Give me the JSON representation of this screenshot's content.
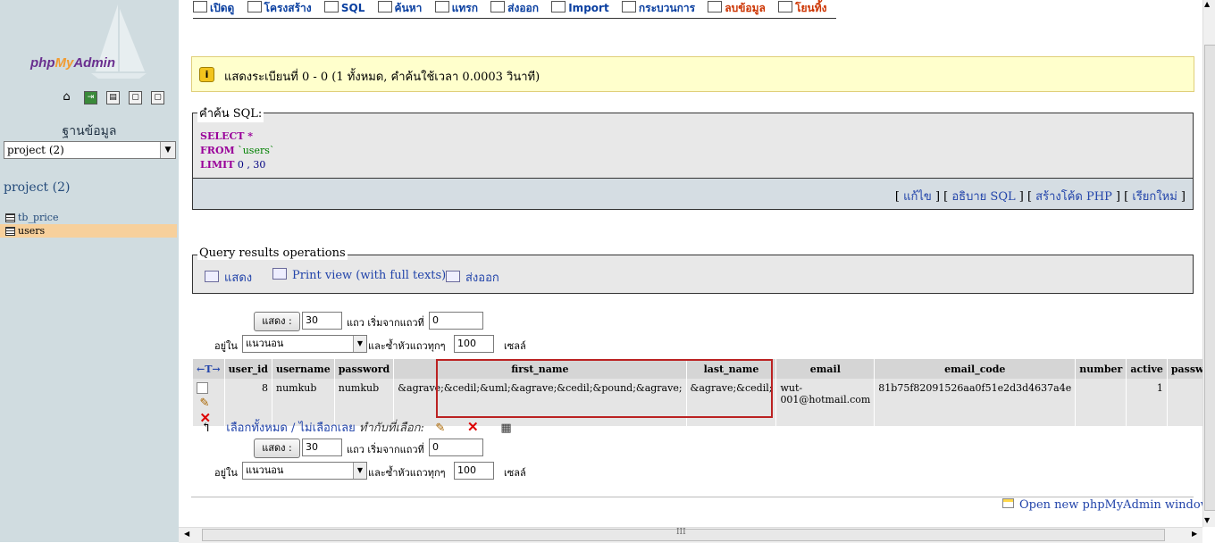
{
  "sidebar": {
    "logo_php": "php",
    "logo_my": "My",
    "logo_admin": "Admin",
    "icons": [
      "home-icon",
      "exit-icon",
      "sql-icon",
      "query-window-icon",
      "documentation-icon"
    ],
    "database_label": "ฐานข้อมูล",
    "database_select": "project (2)",
    "database_name": "project (2)",
    "tables": [
      "tb_price",
      "users"
    ]
  },
  "tabs": [
    {
      "label": "เปิดดู",
      "icon": "browse-icon"
    },
    {
      "label": "โครงสร้าง",
      "icon": "structure-icon"
    },
    {
      "label": "SQL",
      "icon": "sql-icon"
    },
    {
      "label": "ค้นหา",
      "icon": "search-icon"
    },
    {
      "label": "แทรก",
      "icon": "insert-icon"
    },
    {
      "label": "ส่งออก",
      "icon": "export-icon"
    },
    {
      "label": "Import",
      "icon": "import-icon"
    },
    {
      "label": "กระบวนการ",
      "icon": "operations-icon"
    },
    {
      "label": "ลบข้อมูล",
      "icon": "empty-icon"
    },
    {
      "label": "โยนทิ้ง",
      "icon": "drop-icon"
    }
  ],
  "notice": "แสดงระเบียนที่ 0 - 0 (1 ทั้งหมด, คำค้นใช้เวลา 0.0003 วินาที)",
  "sql": {
    "legend": "คำค้น SQL:",
    "select": "SELECT",
    "star": " *",
    "from": "FROM",
    "table": " `users`",
    "limit": "LIMIT",
    "limit_vals": " 0 , 30",
    "links": [
      "แก้ไข",
      "อธิบาย SQL",
      "สร้างโค้ด PHP",
      "เรียกใหม่"
    ]
  },
  "query_ops": {
    "legend": "Query results operations",
    "print": "แสดง",
    "print_full": "Print view (with full texts)",
    "export": "ส่งออก"
  },
  "nav": {
    "show_button": "แสดง :",
    "rows": "30",
    "rows_label": "แถว เริ่มจากแถวที่",
    "start": "0",
    "mode_label": "อยู่ใน",
    "mode": "แนวนอน",
    "repeat_label": "และซ้ำหัวแถวทุกๆ",
    "repeat": "100",
    "cells_label": "เซลล์"
  },
  "table": {
    "arrows": "←T→",
    "headers": [
      "user_id",
      "username",
      "password",
      "first_name",
      "last_name",
      "email",
      "email_code",
      "number",
      "active",
      "password_recov"
    ],
    "row": {
      "user_id": "8",
      "username": "numkub",
      "password": "numkub",
      "first_name": "&agrave;&cedil;&uml;&agrave;&cedil;&pound;&agrave;",
      "last_name": "&agrave;&cedil;",
      "email_line1": "wut-",
      "email_line2": "001@hotmail.com",
      "email_code": "81b75f82091526aa0f51e2d3d4637a4e",
      "number": "",
      "active": "1",
      "password_recov": ""
    }
  },
  "check_all": "เลือกทั้งหมด",
  "separator": " / ",
  "uncheck_all": "ไม่เลือกเลย",
  "with_selected": "ทำกับที่เลือก:",
  "new_window": "Open new phpMyAdmin window",
  "scroll_mark": "III"
}
